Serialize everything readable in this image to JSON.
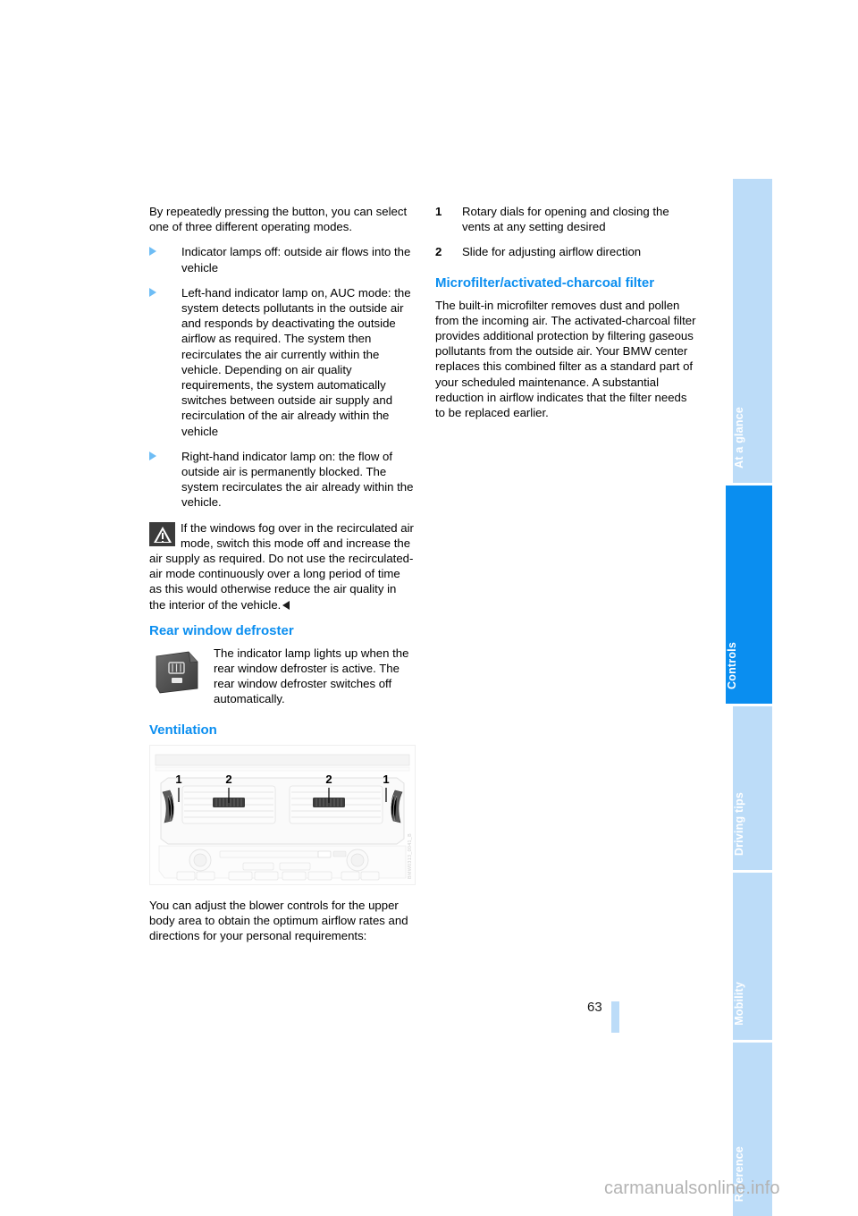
{
  "document": {
    "page_number": "63",
    "watermark": "carmanualsonline.info"
  },
  "tabs": [
    {
      "label": "At a glance",
      "active": false
    },
    {
      "label": "Controls",
      "active": true
    },
    {
      "label": "Driving tips",
      "active": false
    },
    {
      "label": "Mobility",
      "active": false
    },
    {
      "label": "Reference",
      "active": false
    }
  ],
  "left_column": {
    "intro": "By repeatedly pressing the button, you can select one of three different operating modes.",
    "bullets": [
      "Indicator lamps off: outside air flows into the vehicle",
      "Left-hand indicator lamp on, AUC mode: the system detects pollutants in the outside air and responds by deactivating the outside airflow as required. The system then recirculates the air currently within the vehicle. Depending on air quality requirements, the system automatically switches between outside air supply and recirculation of the air already within the vehicle",
      "Right-hand indicator lamp on: the flow of outside air is permanently blocked. The system recirculates the air already within the vehicle."
    ],
    "warning_note": "If the windows fog over in the recirculated air mode, switch this mode off and increase the air supply as required. Do not use the recirculated-air mode continuously over a long period of time as this would otherwise reduce the air quality in the interior of the vehicle.",
    "defroster": {
      "heading": "Rear window defroster",
      "text": "The indicator lamp lights up when the rear window defroster is active. The rear window defroster switches off automatically."
    },
    "ventilation": {
      "heading": "Ventilation",
      "figure_callouts": [
        "1",
        "2",
        "2",
        "1"
      ],
      "figure_code": "BMW0313_0041_B",
      "caption": "You can adjust the blower controls for the upper body area to obtain the optimum airflow rates and directions for your personal requirements:"
    }
  },
  "right_column": {
    "legend": [
      {
        "number": "1",
        "text": "Rotary dials for opening and closing the vents at any setting desired"
      },
      {
        "number": "2",
        "text": "Slide for adjusting airflow direction"
      }
    ],
    "microfilter": {
      "heading": "Microfilter/activated-charcoal filter",
      "text": "The built-in microfilter removes dust and pollen from the incoming air. The activated-charcoal filter provides additional protection by filtering gaseous pollutants from the outside air. Your BMW center replaces this combined filter as a standard part of your scheduled maintenance. A substantial reduction in airflow indicates that the filter needs to be replaced earlier."
    }
  },
  "colors": {
    "accent_blue": "#0a8ef0",
    "tab_inactive": "#bcdcf8",
    "bullet_blue": "#6ebdf5",
    "watermark_gray": "#b3b3b3"
  }
}
